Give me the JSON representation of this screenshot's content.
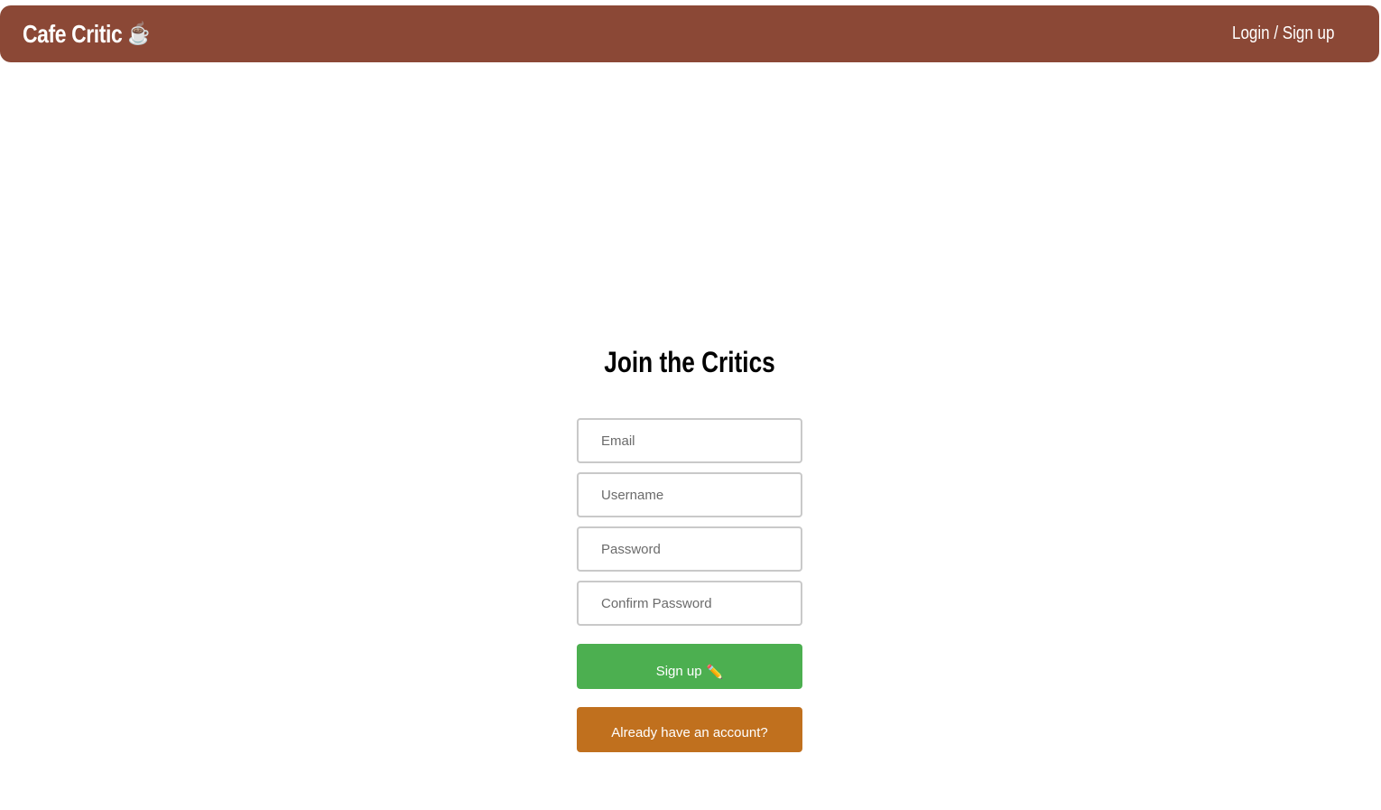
{
  "colors": {
    "navbar_bg": "#8B4836",
    "signup_button_bg": "#4CAF50",
    "login_button_bg": "#C0701E"
  },
  "navbar": {
    "brand": "Cafe Critic",
    "brand_icon": "coffee-cup-icon",
    "brand_icon_glyph": "☕",
    "auth_link": "Login / Sign up"
  },
  "form": {
    "title": "Join the Critics",
    "fields": {
      "email_placeholder": "Email",
      "username_placeholder": "Username",
      "password_placeholder": "Password",
      "confirm_password_placeholder": "Confirm Password"
    },
    "signup_label": "Sign up",
    "signup_icon": "pencil-icon",
    "signup_icon_glyph": "✏️",
    "login_label": "Already have an account?"
  }
}
